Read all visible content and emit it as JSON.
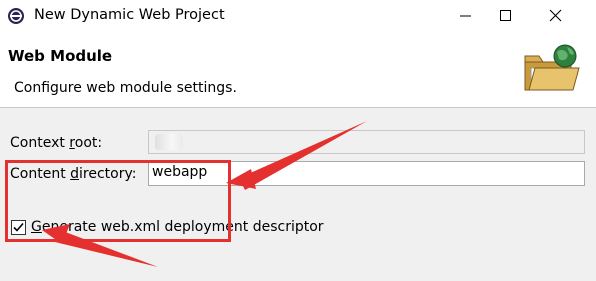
{
  "window": {
    "title": "New Dynamic Web Project",
    "icons": {
      "app": "eclipse-icon",
      "minimize": "minimize-icon",
      "maximize": "maximize-icon",
      "close": "close-icon"
    }
  },
  "banner": {
    "title": "Web Module",
    "description": "Configure web module settings.",
    "icon": "web-folder-globe-icon"
  },
  "form": {
    "context_root": {
      "label_pre": "Context ",
      "label_mnemonic": "r",
      "label_post": "oot:",
      "value": ""
    },
    "content_directory": {
      "label_pre": "Content ",
      "label_mnemonic": "d",
      "label_post": "irectory:",
      "value": "webapp"
    },
    "generate_descriptor": {
      "label_mnemonic": "G",
      "label_post": "enerate web.xml deployment descriptor",
      "checked": true
    }
  },
  "annotation": {
    "color": "#e53030"
  }
}
